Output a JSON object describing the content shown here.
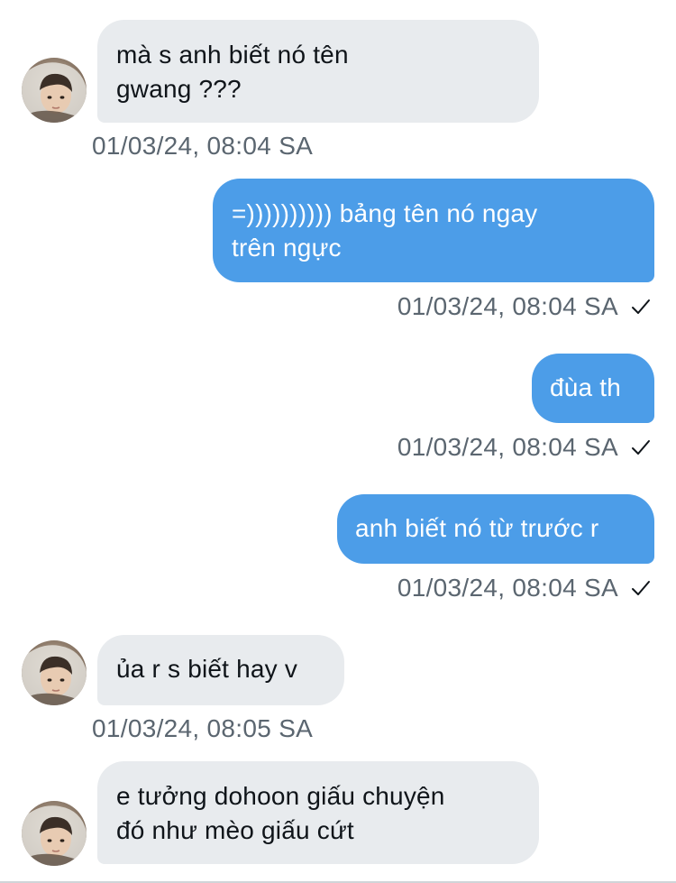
{
  "colors": {
    "incoming_bubble": "#e8ebee",
    "outgoing_bubble": "#4c9de8",
    "timestamp_text": "#5b6670"
  },
  "messages": [
    {
      "direction": "incoming",
      "text_lines": [
        "mà s anh biết nó tên",
        "gwang ???"
      ],
      "timestamp": "01/03/24, 08:04 SA"
    },
    {
      "direction": "outgoing",
      "text_lines": [
        "=)))))))))) bảng tên nó ngay",
        "trên ngực"
      ],
      "timestamp": "01/03/24, 08:04 SA",
      "status_icon": "check-icon"
    },
    {
      "direction": "outgoing",
      "text_lines": [
        "đùa th"
      ],
      "timestamp": "01/03/24, 08:04 SA",
      "status_icon": "check-icon"
    },
    {
      "direction": "outgoing",
      "text_lines": [
        "anh biết nó từ trước r"
      ],
      "timestamp": "01/03/24, 08:04 SA",
      "status_icon": "check-icon"
    },
    {
      "direction": "incoming",
      "text_lines": [
        "ủa r s biết hay v"
      ],
      "timestamp": "01/03/24, 08:05 SA"
    },
    {
      "direction": "incoming",
      "text_lines": [
        "e tưởng dohoon giấu chuyện",
        "đó như mèo giấu cứt"
      ]
    }
  ]
}
